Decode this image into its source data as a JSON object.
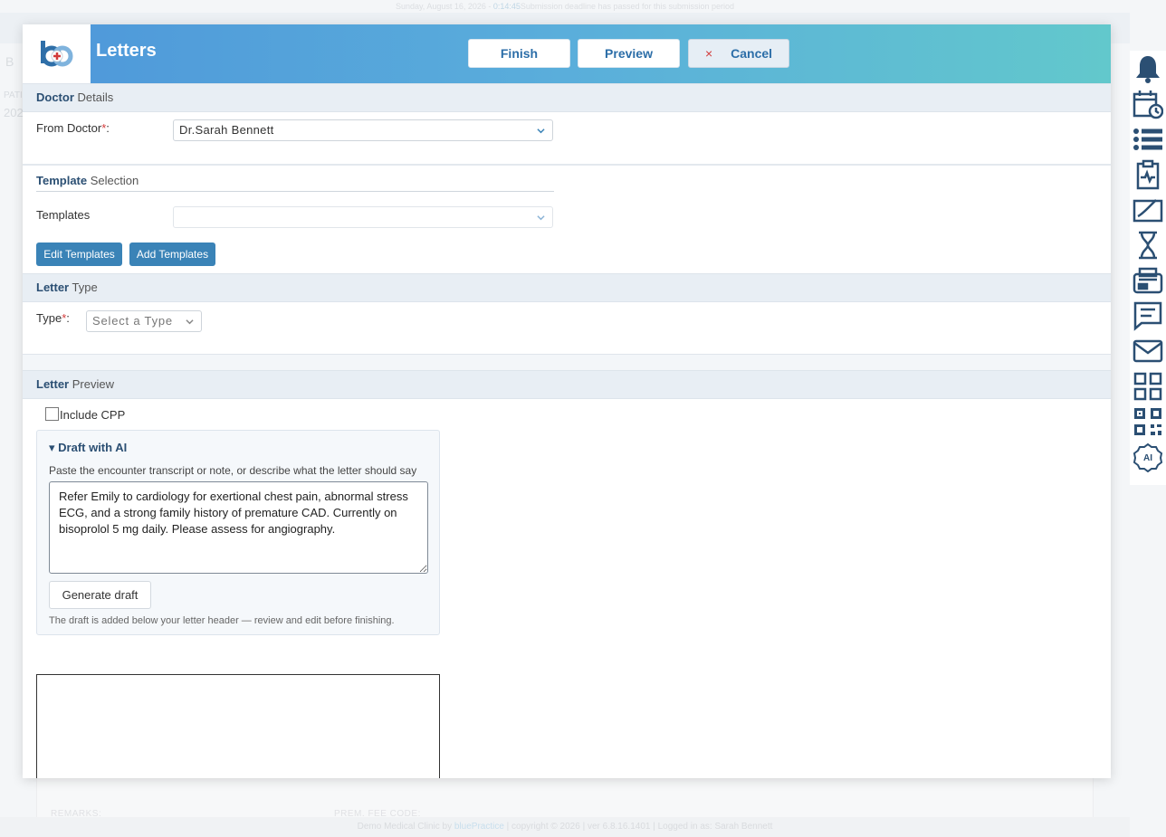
{
  "background": {
    "date_line": "Sunday, August 16, 2026 - ",
    "countdown": "0:14:45",
    "deadline_msg": "Submission deadline has passed for this submission period",
    "sub_label": "B",
    "pat_label": "PATI",
    "year_label": "202",
    "remarks_label": "REMARKS:",
    "prem_label": "PREM. FEE CODE:",
    "footer_clinic": "Demo Medical Clinic by ",
    "footer_brand": "bluePractice",
    "footer_rest": "  |   copyright © 2026   |   ver 6.8.16.1401   |   Logged in as: Sarah Bennett"
  },
  "modal": {
    "title": "Letters",
    "finish_label": "Finish",
    "preview_label": "Preview",
    "cancel_label": "Cancel",
    "cancel_icon": "×"
  },
  "doctor_section": {
    "title_bold": "Doctor",
    "title_rest": " Details",
    "from_label": "From Doctor",
    "required_mark": "*",
    "colon": ":",
    "selected": "Dr.Sarah Bennett"
  },
  "template_section": {
    "title_bold": "Template",
    "title_rest": " Selection",
    "templates_label": "Templates",
    "templates_value": "",
    "edit_button": "Edit Templates",
    "add_button": "Add Templates"
  },
  "type_section": {
    "title_bold": "Letter",
    "title_rest": " Type",
    "type_label": "Type",
    "required_mark": "*",
    "colon": ":",
    "type_placeholder": "Select a Type"
  },
  "preview_section": {
    "title_bold": "Letter",
    "title_rest": " Preview",
    "include_cpp_label": "Include CPP",
    "draft": {
      "heading": "▾ Draft with AI",
      "hint": "Paste the encounter transcript or note, or describe what the letter should say",
      "text": "Refer Emily to cardiology for exertional chest pain, abnormal stress ECG, and a strong family history of premature CAD. Currently on bisoprolol 5 mg daily. Please assess for angiography.",
      "generate_button": "Generate draft",
      "note": "The draft is added below your letter header — review and edit before finishing."
    }
  },
  "right_bar_icons": [
    "bell-icon",
    "calendar-clock-icon",
    "list-icon",
    "clipboard-pulse-icon",
    "signature-icon",
    "hourglass-icon",
    "fax-icon",
    "chat-icon",
    "mail-icon",
    "apps-grid-icon",
    "qr-code-icon",
    "ai-icon"
  ],
  "colors": {
    "header_start": "#4e97da",
    "header_end": "#62c8cc",
    "accent": "#2b4f73",
    "button_blue": "#3a83b7",
    "required": "#d23b3b"
  }
}
